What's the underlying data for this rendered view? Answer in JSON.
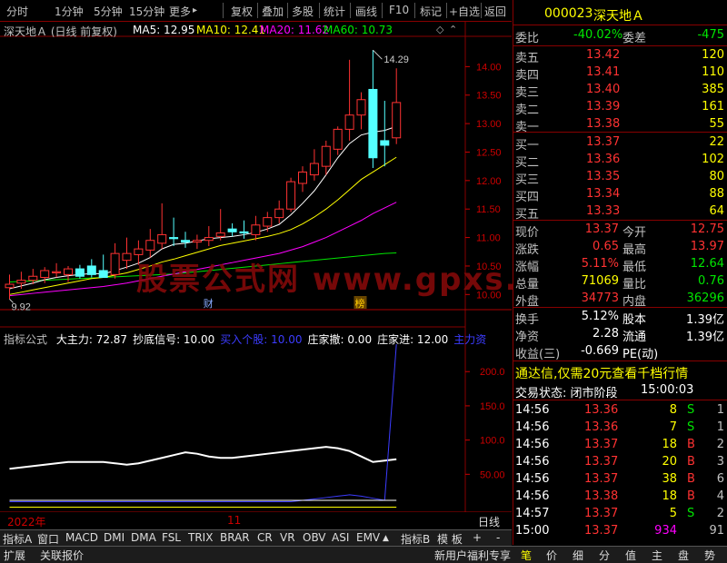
{
  "toolbar": {
    "left_items": [
      "分时",
      "1分钟",
      "5分钟",
      "15分钟",
      "更多"
    ],
    "right_items": [
      "复权",
      "叠加",
      "多股",
      "统计",
      "画线",
      "F10",
      "标记",
      "+自选",
      "返回"
    ],
    "more_arrow": "▸"
  },
  "chart_header": {
    "title": "深天地Ａ (日线 前复权)",
    "ma5": "MA5: 12.95",
    "ma10": "MA10: 12.41",
    "ma20": "MA20: 11.62",
    "ma60": "MA60: 10.73",
    "colors": {
      "ma5": "#ffffff",
      "ma10": "#ffff00",
      "ma20": "#ff00ff",
      "ma60": "#00e600"
    }
  },
  "chart_data": [
    {
      "type": "candlestick",
      "y_ticks": [
        "14.00",
        "13.50",
        "13.00",
        "12.50",
        "12.00",
        "11.50",
        "11.00",
        "10.50",
        "10.00"
      ],
      "y_values": [
        14.0,
        13.5,
        13.0,
        12.5,
        12.0,
        11.5,
        11.0,
        10.5,
        10.0
      ],
      "ylim": [
        9.75,
        14.5
      ],
      "high_label": "14.29",
      "low_label": "9.92",
      "event_labels": [
        "财",
        "榜"
      ],
      "candles": [
        {
          "o": 10.12,
          "h": 10.35,
          "l": 9.92,
          "c": 10.18
        },
        {
          "o": 10.2,
          "h": 10.4,
          "l": 10.1,
          "c": 10.25
        },
        {
          "o": 10.25,
          "h": 10.45,
          "l": 10.18,
          "c": 10.32
        },
        {
          "o": 10.3,
          "h": 10.48,
          "l": 10.2,
          "c": 10.42
        },
        {
          "o": 10.38,
          "h": 10.55,
          "l": 10.3,
          "c": 10.4
        },
        {
          "o": 10.35,
          "h": 10.5,
          "l": 10.22,
          "c": 10.45
        },
        {
          "o": 10.45,
          "h": 10.52,
          "l": 10.28,
          "c": 10.32
        },
        {
          "o": 10.5,
          "h": 10.62,
          "l": 10.3,
          "c": 10.35
        },
        {
          "o": 10.42,
          "h": 10.7,
          "l": 10.35,
          "c": 10.3
        },
        {
          "o": 10.35,
          "h": 10.9,
          "l": 10.28,
          "c": 10.72
        },
        {
          "o": 10.6,
          "h": 11.0,
          "l": 10.45,
          "c": 10.72
        },
        {
          "o": 10.7,
          "h": 10.95,
          "l": 10.52,
          "c": 10.8
        },
        {
          "o": 10.78,
          "h": 11.15,
          "l": 10.65,
          "c": 10.95
        },
        {
          "o": 10.9,
          "h": 11.6,
          "l": 10.8,
          "c": 11.05
        },
        {
          "o": 11.0,
          "h": 11.35,
          "l": 10.85,
          "c": 10.98
        },
        {
          "o": 10.95,
          "h": 11.1,
          "l": 10.82,
          "c": 10.92
        },
        {
          "o": 10.92,
          "h": 11.05,
          "l": 10.8,
          "c": 10.95
        },
        {
          "o": 10.95,
          "h": 11.2,
          "l": 10.85,
          "c": 11.0
        },
        {
          "o": 11.02,
          "h": 11.5,
          "l": 10.95,
          "c": 11.08
        },
        {
          "o": 11.15,
          "h": 11.25,
          "l": 11.02,
          "c": 11.1
        },
        {
          "o": 11.1,
          "h": 11.3,
          "l": 10.98,
          "c": 11.08
        },
        {
          "o": 11.05,
          "h": 11.38,
          "l": 10.95,
          "c": 11.22
        },
        {
          "o": 11.2,
          "h": 11.45,
          "l": 11.1,
          "c": 11.35
        },
        {
          "o": 11.35,
          "h": 11.65,
          "l": 11.25,
          "c": 11.5
        },
        {
          "o": 11.5,
          "h": 12.05,
          "l": 11.45,
          "c": 11.98
        },
        {
          "o": 11.95,
          "h": 12.25,
          "l": 11.8,
          "c": 12.15
        },
        {
          "o": 12.1,
          "h": 12.55,
          "l": 12.0,
          "c": 12.3
        },
        {
          "o": 12.25,
          "h": 12.7,
          "l": 12.1,
          "c": 12.6
        },
        {
          "o": 12.55,
          "h": 12.95,
          "l": 12.45,
          "c": 12.9
        },
        {
          "o": 12.9,
          "h": 14.12,
          "l": 12.7,
          "c": 13.15
        },
        {
          "o": 13.15,
          "h": 13.55,
          "l": 12.9,
          "c": 13.42
        },
        {
          "o": 13.6,
          "h": 14.29,
          "l": 12.22,
          "c": 12.4
        },
        {
          "o": 12.7,
          "h": 13.4,
          "l": 12.25,
          "c": 12.62
        },
        {
          "o": 12.75,
          "h": 13.97,
          "l": 12.64,
          "c": 13.37
        }
      ],
      "ma5": [
        10.1,
        10.15,
        10.2,
        10.26,
        10.3,
        10.33,
        10.35,
        10.37,
        10.36,
        10.42,
        10.48,
        10.55,
        10.65,
        10.8,
        10.88,
        10.9,
        10.94,
        10.98,
        11.0,
        11.02,
        11.05,
        11.09,
        11.15,
        11.23,
        11.4,
        11.6,
        11.82,
        12.1,
        12.4,
        12.65,
        12.8,
        12.85,
        12.88,
        12.95
      ],
      "ma10": [
        10.0,
        10.04,
        10.08,
        10.12,
        10.16,
        10.2,
        10.24,
        10.28,
        10.3,
        10.34,
        10.38,
        10.44,
        10.5,
        10.57,
        10.62,
        10.68,
        10.74,
        10.8,
        10.86,
        10.9,
        10.94,
        10.98,
        11.02,
        11.07,
        11.14,
        11.24,
        11.36,
        11.5,
        11.66,
        11.84,
        12.02,
        12.15,
        12.28,
        12.41
      ],
      "ma20": [
        9.98,
        10.0,
        10.02,
        10.04,
        10.06,
        10.08,
        10.1,
        10.12,
        10.14,
        10.17,
        10.2,
        10.24,
        10.28,
        10.32,
        10.36,
        10.4,
        10.44,
        10.48,
        10.52,
        10.56,
        10.6,
        10.64,
        10.68,
        10.72,
        10.78,
        10.84,
        10.92,
        11.0,
        11.1,
        11.2,
        11.3,
        11.42,
        11.52,
        11.62
      ],
      "ma60": [
        10.22,
        10.23,
        10.24,
        10.25,
        10.26,
        10.27,
        10.28,
        10.29,
        10.3,
        10.31,
        10.32,
        10.33,
        10.34,
        10.35,
        10.36,
        10.38,
        10.4,
        10.42,
        10.44,
        10.46,
        10.48,
        10.5,
        10.52,
        10.54,
        10.56,
        10.58,
        10.6,
        10.62,
        10.64,
        10.66,
        10.68,
        10.7,
        10.72,
        10.73
      ]
    },
    {
      "type": "line",
      "y_ticks": [
        "200.0",
        "150.0",
        "100.0",
        "50.00"
      ],
      "y_values": [
        200,
        150,
        100,
        50
      ],
      "ylim": [
        0,
        260
      ],
      "series": [
        {
          "name": "大主力",
          "color": "#ffffff",
          "values": [
            58,
            60,
            62,
            64,
            66,
            68,
            68,
            68,
            68,
            66,
            64,
            66,
            70,
            74,
            78,
            82,
            80,
            76,
            74,
            74,
            76,
            78,
            80,
            82,
            84,
            86,
            88,
            90,
            88,
            84,
            76,
            68,
            70,
            72
          ]
        },
        {
          "name": "抄底信号",
          "color": "#ffff00",
          "values": [
            2,
            2,
            2,
            2,
            2,
            2,
            2,
            2,
            2,
            2,
            2,
            2,
            2,
            2,
            2,
            2,
            2,
            2,
            2,
            2,
            2,
            2,
            2,
            2,
            2,
            2,
            2,
            2,
            2,
            2,
            2,
            2,
            2,
            2
          ]
        },
        {
          "name": "买入个股",
          "color": "#3c3cff",
          "values": [
            10,
            10,
            10,
            10,
            10,
            10,
            10,
            10,
            10,
            10,
            10,
            10,
            10,
            10,
            10,
            10,
            10,
            10,
            10,
            10,
            10,
            10,
            10,
            10,
            10,
            12,
            14,
            16,
            18,
            20,
            18,
            15,
            12,
            240
          ]
        },
        {
          "name": "庄家进",
          "color": "#ffffff",
          "values": [
            12,
            12,
            12,
            12,
            12,
            12,
            12,
            12,
            12,
            12,
            12,
            12,
            12,
            12,
            12,
            12,
            12,
            12,
            12,
            12,
            12,
            12,
            12,
            12,
            12,
            12,
            12,
            12,
            12,
            12,
            12,
            12,
            12,
            12
          ]
        }
      ]
    }
  ],
  "indicator_header": {
    "name": "指标公式",
    "items": [
      {
        "text": "大主力: 72.87",
        "color": "#ffffff"
      },
      {
        "text": "抄底信号: 10.00",
        "color": "#ffffff"
      },
      {
        "text": "买入个股: 10.00",
        "color": "#3c3cff"
      },
      {
        "text": "庄家撤: 0.00",
        "color": "#ffffff"
      },
      {
        "text": "庄家进: 12.00",
        "color": "#ffffff"
      },
      {
        "text": "主力资",
        "color": "#3c3cff"
      }
    ]
  },
  "date_axis": {
    "year": "2022年",
    "month": "11",
    "period": "日线"
  },
  "watermark": "股票公式网 www.gpxs.com",
  "quote": {
    "code": "000023",
    "name": "深天地Ａ",
    "weibi_label": "委比",
    "weibi": "-40.02%",
    "weicha_label": "委差",
    "weicha": "-475",
    "sell": [
      {
        "label": "卖五",
        "price": "13.42",
        "vol": "120"
      },
      {
        "label": "卖四",
        "price": "13.41",
        "vol": "110"
      },
      {
        "label": "卖三",
        "price": "13.40",
        "vol": "385"
      },
      {
        "label": "卖二",
        "price": "13.39",
        "vol": "161"
      },
      {
        "label": "卖一",
        "price": "13.38",
        "vol": "55"
      }
    ],
    "buy": [
      {
        "label": "买一",
        "price": "13.37",
        "vol": "22"
      },
      {
        "label": "买二",
        "price": "13.36",
        "vol": "102"
      },
      {
        "label": "买三",
        "price": "13.35",
        "vol": "80"
      },
      {
        "label": "买四",
        "price": "13.34",
        "vol": "88"
      },
      {
        "label": "买五",
        "price": "13.33",
        "vol": "64"
      }
    ],
    "stats": [
      {
        "l1": "现价",
        "v1": "13.37",
        "c1": "red",
        "l2": "今开",
        "v2": "12.75",
        "c2": "red"
      },
      {
        "l1": "涨跌",
        "v1": "0.65",
        "c1": "red",
        "l2": "最高",
        "v2": "13.97",
        "c2": "red"
      },
      {
        "l1": "涨幅",
        "v1": "5.11%",
        "c1": "red",
        "l2": "最低",
        "v2": "12.64",
        "c2": "green"
      },
      {
        "l1": "总量",
        "v1": "71069",
        "c1": "yellow",
        "l2": "量比",
        "v2": "0.76",
        "c2": "green"
      },
      {
        "l1": "外盘",
        "v1": "34773",
        "c1": "red",
        "l2": "内盘",
        "v2": "36296",
        "c2": "green"
      }
    ],
    "stats2": [
      {
        "l1": "换手",
        "v1": "5.12%",
        "l2": "股本",
        "v2": "1.39亿"
      },
      {
        "l1": "净资",
        "v1": "2.28",
        "l2": "流通",
        "v2": "1.39亿"
      },
      {
        "l1": "收益(三)",
        "v1": "-0.669",
        "l2": "PE(动)",
        "v2": ""
      }
    ],
    "promo": "通达信,仅需20元查看千档行情",
    "trade_status_label": "交易状态: 闭市阶段",
    "trade_status_time": "15:00:03",
    "ticks": [
      {
        "t": "14:56",
        "p": "13.36",
        "v": "8",
        "d": "S",
        "n": "1"
      },
      {
        "t": "14:56",
        "p": "13.36",
        "v": "7",
        "d": "S",
        "n": "1"
      },
      {
        "t": "14:56",
        "p": "13.37",
        "v": "18",
        "d": "B",
        "n": "2"
      },
      {
        "t": "14:56",
        "p": "13.37",
        "v": "20",
        "d": "B",
        "n": "3"
      },
      {
        "t": "14:56",
        "p": "13.37",
        "v": "38",
        "d": "B",
        "n": "6"
      },
      {
        "t": "14:56",
        "p": "13.38",
        "v": "18",
        "d": "B",
        "n": "4"
      },
      {
        "t": "14:57",
        "p": "13.37",
        "v": "5",
        "d": "S",
        "n": "2"
      },
      {
        "t": "15:00",
        "p": "13.37",
        "v": "934",
        "d": "",
        "n": "91"
      }
    ]
  },
  "bottom_tabs": {
    "items": [
      "指标A",
      "窗口",
      "MACD",
      "DMI",
      "DMA",
      "FSL",
      "TRIX",
      "BRAR",
      "CR",
      "VR",
      "OBV",
      "ASI",
      "EMV"
    ],
    "right": [
      "指标B",
      "模 板",
      "+",
      "-"
    ]
  },
  "status_bar": {
    "left": [
      "扩展",
      "关联报价"
    ],
    "promo": "新用户福利专享",
    "tabs": [
      "笔",
      "价",
      "细",
      "分",
      "值",
      "主",
      "盘",
      "势"
    ]
  }
}
